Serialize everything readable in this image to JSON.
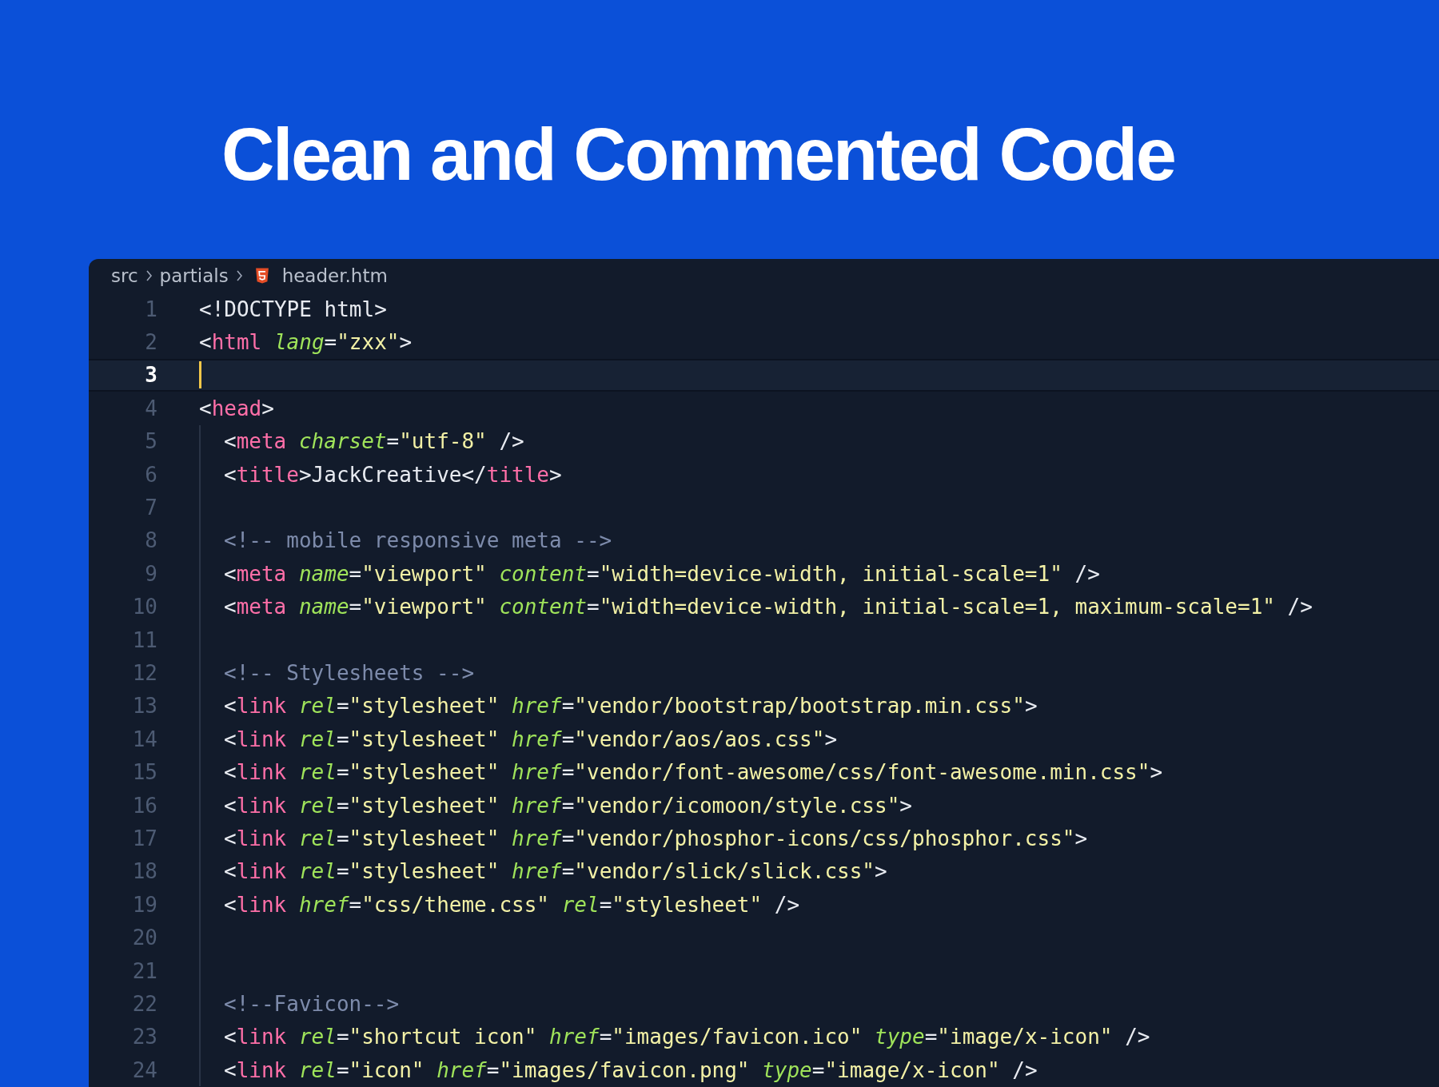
{
  "headline": "Clean and Commented Code",
  "breadcrumb": [
    {
      "label": "src",
      "kind": "folder"
    },
    {
      "label": "partials",
      "kind": "folder"
    },
    {
      "label": "header.htm",
      "kind": "html-file"
    }
  ],
  "lines": [
    {
      "number": "1",
      "selected": false,
      "tokens": [
        {
          "kind": "punct",
          "text": "<!DOCTYPE html>"
        }
      ]
    },
    {
      "number": "2",
      "selected": false,
      "tokens": [
        {
          "kind": "punct",
          "text": "<"
        },
        {
          "kind": "tag",
          "text": "html"
        },
        {
          "kind": "attr",
          "text": " lang"
        },
        {
          "kind": "punct",
          "text": "="
        },
        {
          "kind": "string",
          "text": "\"zxx\""
        },
        {
          "kind": "punct",
          "text": ">"
        }
      ]
    },
    {
      "number": "3",
      "selected": true
    },
    {
      "number": "4",
      "selected": false,
      "tokens": [
        {
          "kind": "punct",
          "text": "<"
        },
        {
          "kind": "tag",
          "text": "head"
        },
        {
          "kind": "punct",
          "text": ">"
        }
      ],
      "children": [
        {
          "number": "5",
          "selected": false,
          "tokens": [
            {
              "kind": "punct",
              "text": "<"
            },
            {
              "kind": "tag",
              "text": "meta"
            },
            {
              "kind": "attr",
              "text": " charset"
            },
            {
              "kind": "punct",
              "text": "="
            },
            {
              "kind": "string",
              "text": "\"utf-8\""
            },
            {
              "kind": "punct",
              "text": " />"
            }
          ]
        },
        {
          "number": "6",
          "selected": false,
          "tokens": [
            {
              "kind": "punct",
              "text": "<"
            },
            {
              "kind": "tag",
              "text": "title"
            },
            {
              "kind": "punct",
              "text": ">"
            },
            {
              "kind": "text",
              "text": "JackCreative"
            },
            {
              "kind": "punct",
              "text": "</"
            },
            {
              "kind": "tag",
              "text": "title"
            },
            {
              "kind": "punct",
              "text": ">"
            }
          ]
        },
        {
          "number": "7",
          "selected": false
        },
        {
          "number": "8",
          "selected": false,
          "tokens": [
            {
              "kind": "comment",
              "text": "<!-- mobile responsive meta -->"
            }
          ]
        },
        {
          "number": "9",
          "selected": false,
          "tokens": [
            {
              "kind": "punct",
              "text": "<"
            },
            {
              "kind": "tag",
              "text": "meta"
            },
            {
              "kind": "attr",
              "text": " name"
            },
            {
              "kind": "punct",
              "text": "="
            },
            {
              "kind": "string",
              "text": "\"viewport\""
            },
            {
              "kind": "attr",
              "text": " content"
            },
            {
              "kind": "punct",
              "text": "="
            },
            {
              "kind": "string",
              "text": "\"width=device-width, initial-scale=1\""
            },
            {
              "kind": "punct",
              "text": " />"
            }
          ]
        },
        {
          "number": "10",
          "selected": false,
          "tokens": [
            {
              "kind": "punct",
              "text": "<"
            },
            {
              "kind": "tag",
              "text": "meta"
            },
            {
              "kind": "attr",
              "text": " name"
            },
            {
              "kind": "punct",
              "text": "="
            },
            {
              "kind": "string",
              "text": "\"viewport\""
            },
            {
              "kind": "attr",
              "text": " content"
            },
            {
              "kind": "punct",
              "text": "="
            },
            {
              "kind": "string",
              "text": "\"width=device-width, initial-scale=1, maximum-scale=1\""
            },
            {
              "kind": "punct",
              "text": " />"
            }
          ]
        },
        {
          "number": "11",
          "selected": false
        },
        {
          "number": "12",
          "selected": false,
          "tokens": [
            {
              "kind": "comment",
              "text": "<!-- Stylesheets -->"
            }
          ]
        },
        {
          "number": "13",
          "selected": false,
          "tokens": [
            {
              "kind": "punct",
              "text": "<"
            },
            {
              "kind": "tag",
              "text": "link"
            },
            {
              "kind": "attr",
              "text": " rel"
            },
            {
              "kind": "punct",
              "text": "="
            },
            {
              "kind": "string",
              "text": "\"stylesheet\""
            },
            {
              "kind": "attr",
              "text": " href"
            },
            {
              "kind": "punct",
              "text": "="
            },
            {
              "kind": "string",
              "text": "\"vendor/bootstrap/bootstrap.min.css\""
            },
            {
              "kind": "punct",
              "text": ">"
            }
          ]
        },
        {
          "number": "14",
          "selected": false,
          "tokens": [
            {
              "kind": "punct",
              "text": "<"
            },
            {
              "kind": "tag",
              "text": "link"
            },
            {
              "kind": "attr",
              "text": " rel"
            },
            {
              "kind": "punct",
              "text": "="
            },
            {
              "kind": "string",
              "text": "\"stylesheet\""
            },
            {
              "kind": "attr",
              "text": " href"
            },
            {
              "kind": "punct",
              "text": "="
            },
            {
              "kind": "string",
              "text": "\"vendor/aos/aos.css\""
            },
            {
              "kind": "punct",
              "text": ">"
            }
          ]
        },
        {
          "number": "15",
          "selected": false,
          "tokens": [
            {
              "kind": "punct",
              "text": "<"
            },
            {
              "kind": "tag",
              "text": "link"
            },
            {
              "kind": "attr",
              "text": " rel"
            },
            {
              "kind": "punct",
              "text": "="
            },
            {
              "kind": "string",
              "text": "\"stylesheet\""
            },
            {
              "kind": "attr",
              "text": " href"
            },
            {
              "kind": "punct",
              "text": "="
            },
            {
              "kind": "string",
              "text": "\"vendor/font-awesome/css/font-awesome.min.css\""
            },
            {
              "kind": "punct",
              "text": ">"
            }
          ]
        },
        {
          "number": "16",
          "selected": false,
          "tokens": [
            {
              "kind": "punct",
              "text": "<"
            },
            {
              "kind": "tag",
              "text": "link"
            },
            {
              "kind": "attr",
              "text": " rel"
            },
            {
              "kind": "punct",
              "text": "="
            },
            {
              "kind": "string",
              "text": "\"stylesheet\""
            },
            {
              "kind": "attr",
              "text": " href"
            },
            {
              "kind": "punct",
              "text": "="
            },
            {
              "kind": "string",
              "text": "\"vendor/icomoon/style.css\""
            },
            {
              "kind": "punct",
              "text": ">"
            }
          ]
        },
        {
          "number": "17",
          "selected": false,
          "tokens": [
            {
              "kind": "punct",
              "text": "<"
            },
            {
              "kind": "tag",
              "text": "link"
            },
            {
              "kind": "attr",
              "text": " rel"
            },
            {
              "kind": "punct",
              "text": "="
            },
            {
              "kind": "string",
              "text": "\"stylesheet\""
            },
            {
              "kind": "attr",
              "text": " href"
            },
            {
              "kind": "punct",
              "text": "="
            },
            {
              "kind": "string",
              "text": "\"vendor/phosphor-icons/css/phosphor.css\""
            },
            {
              "kind": "punct",
              "text": ">"
            }
          ]
        },
        {
          "number": "18",
          "selected": false,
          "tokens": [
            {
              "kind": "punct",
              "text": "<"
            },
            {
              "kind": "tag",
              "text": "link"
            },
            {
              "kind": "attr",
              "text": " rel"
            },
            {
              "kind": "punct",
              "text": "="
            },
            {
              "kind": "string",
              "text": "\"stylesheet\""
            },
            {
              "kind": "attr",
              "text": " href"
            },
            {
              "kind": "punct",
              "text": "="
            },
            {
              "kind": "string",
              "text": "\"vendor/slick/slick.css\""
            },
            {
              "kind": "punct",
              "text": ">"
            }
          ]
        },
        {
          "number": "19",
          "selected": false,
          "tokens": [
            {
              "kind": "punct",
              "text": "<"
            },
            {
              "kind": "tag",
              "text": "link"
            },
            {
              "kind": "attr",
              "text": " href"
            },
            {
              "kind": "punct",
              "text": "="
            },
            {
              "kind": "string",
              "text": "\"css/theme.css\""
            },
            {
              "kind": "attr",
              "text": " rel"
            },
            {
              "kind": "punct",
              "text": "="
            },
            {
              "kind": "string",
              "text": "\"stylesheet\""
            },
            {
              "kind": "punct",
              "text": " />"
            }
          ]
        },
        {
          "number": "20",
          "selected": false
        },
        {
          "number": "21",
          "selected": false
        },
        {
          "number": "22",
          "selected": false,
          "tokens": [
            {
              "kind": "comment",
              "text": "<!--Favicon-->"
            }
          ]
        },
        {
          "number": "23",
          "selected": false,
          "tokens": [
            {
              "kind": "punct",
              "text": "<"
            },
            {
              "kind": "tag",
              "text": "link"
            },
            {
              "kind": "attr",
              "text": " rel"
            },
            {
              "kind": "punct",
              "text": "="
            },
            {
              "kind": "string",
              "text": "\"shortcut icon\""
            },
            {
              "kind": "attr",
              "text": " href"
            },
            {
              "kind": "punct",
              "text": "="
            },
            {
              "kind": "string",
              "text": "\"images/favicon.ico\""
            },
            {
              "kind": "attr",
              "text": " type"
            },
            {
              "kind": "punct",
              "text": "="
            },
            {
              "kind": "string",
              "text": "\"image/x-icon\""
            },
            {
              "kind": "punct",
              "text": " />"
            }
          ]
        },
        {
          "number": "24",
          "selected": false,
          "tokens": [
            {
              "kind": "punct",
              "text": "<"
            },
            {
              "kind": "tag",
              "text": "link"
            },
            {
              "kind": "attr",
              "text": " rel"
            },
            {
              "kind": "punct",
              "text": "="
            },
            {
              "kind": "string",
              "text": "\"icon\""
            },
            {
              "kind": "attr",
              "text": " href"
            },
            {
              "kind": "punct",
              "text": "="
            },
            {
              "kind": "string",
              "text": "\"images/favicon.png\""
            },
            {
              "kind": "attr",
              "text": " type"
            },
            {
              "kind": "punct",
              "text": "="
            },
            {
              "kind": "string",
              "text": "\"image/x-icon\""
            },
            {
              "kind": "punct",
              "text": " />"
            }
          ]
        }
      ]
    }
  ]
}
